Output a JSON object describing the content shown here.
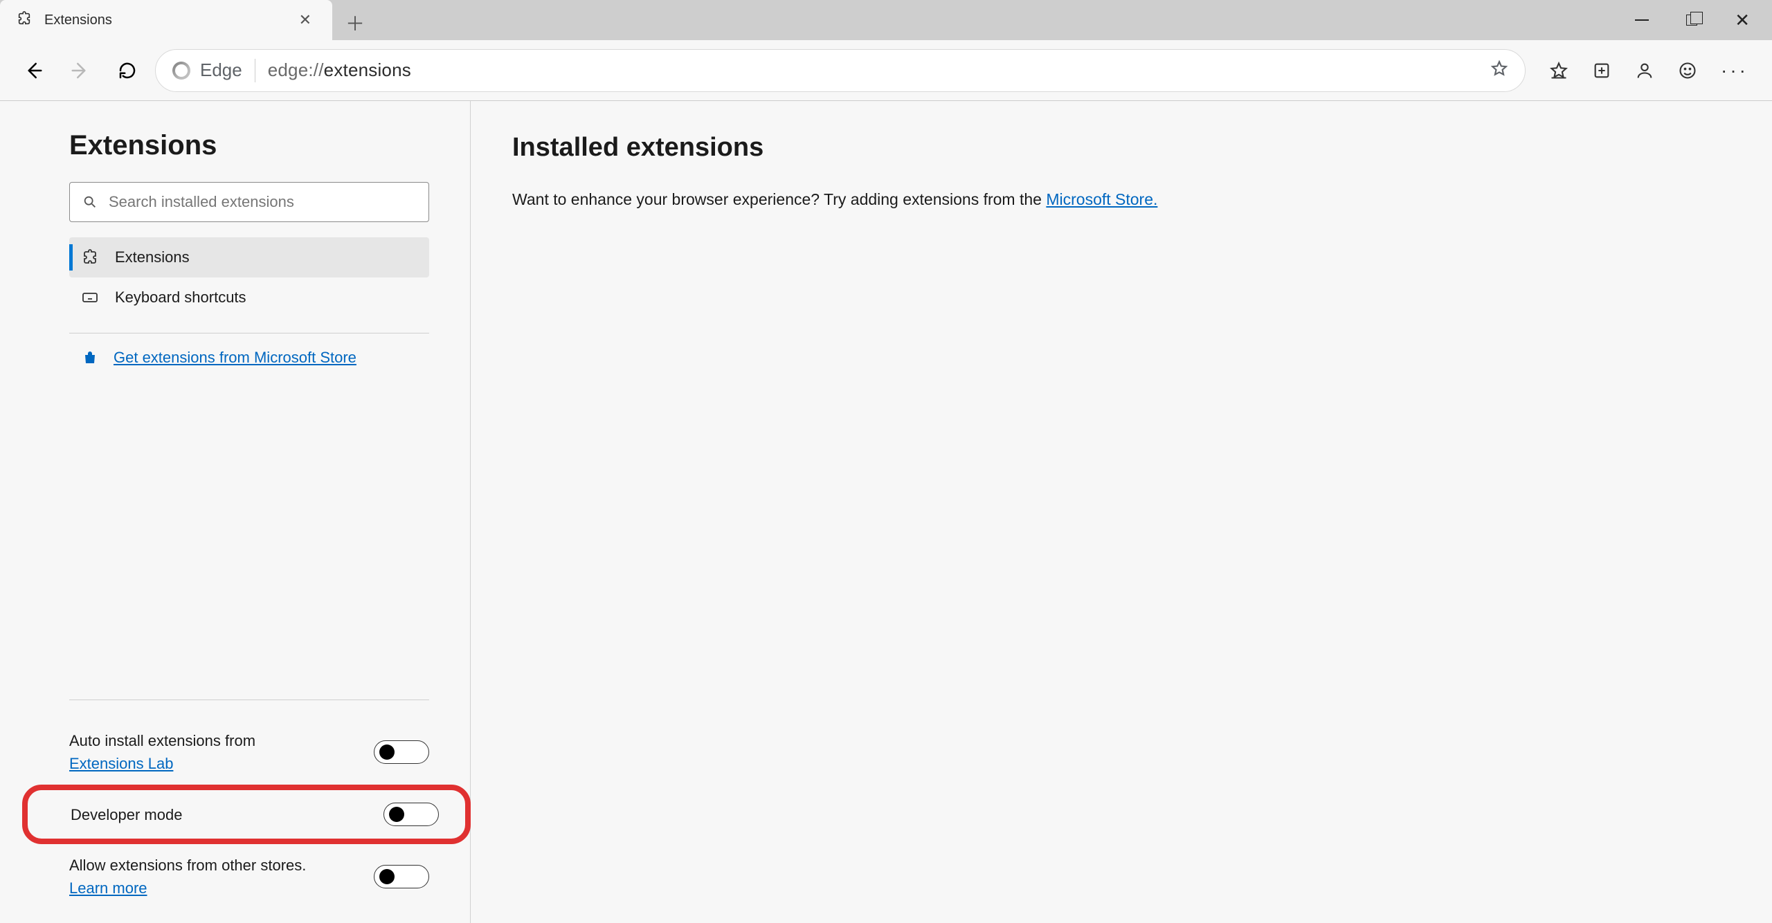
{
  "window": {
    "tab_title": "Extensions"
  },
  "toolbar": {
    "edge_label": "Edge",
    "url_scheme": "edge://",
    "url_path": "extensions"
  },
  "sidebar": {
    "title": "Extensions",
    "search_placeholder": "Search installed extensions",
    "nav": {
      "extensions": "Extensions",
      "keyboard_shortcuts": "Keyboard shortcuts"
    },
    "store_link": "Get extensions from Microsoft Store",
    "toggles": {
      "auto_install_prefix": "Auto install extensions from ",
      "auto_install_link": "Extensions Lab",
      "developer_mode": "Developer mode",
      "allow_other_prefix": "Allow extensions from other stores. ",
      "allow_other_link": "Learn more"
    }
  },
  "main": {
    "heading": "Installed extensions",
    "prompt_prefix": "Want to enhance your browser experience? Try adding extensions from the ",
    "prompt_link": "Microsoft Store."
  }
}
